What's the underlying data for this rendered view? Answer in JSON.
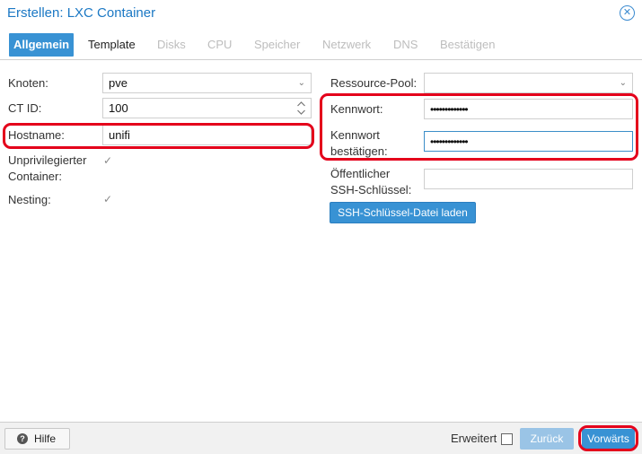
{
  "window": {
    "title": "Erstellen: LXC Container"
  },
  "tabs": [
    "Allgemein",
    "Template",
    "Disks",
    "CPU",
    "Speicher",
    "Netzwerk",
    "DNS",
    "Bestätigen"
  ],
  "left": {
    "node_label": "Knoten:",
    "node_value": "pve",
    "ctid_label": "CT ID:",
    "ctid_value": "100",
    "hostname_label": "Hostname:",
    "hostname_value": "unifi",
    "unpriv_label_1": "Unprivilegierter",
    "unpriv_label_2": "Container:",
    "nesting_label": "Nesting:"
  },
  "right": {
    "pool_label": "Ressource-Pool:",
    "password_label": "Kennwort:",
    "password_value": "•••••••••••••",
    "confirm_label_1": "Kennwort",
    "confirm_label_2": "bestätigen:",
    "confirm_value": "•••••••••••••",
    "ssh_label_1": "Öffentlicher",
    "ssh_label_2": "SSH-Schlüssel:",
    "ssh_button": "SSH-Schlüssel-Datei laden"
  },
  "footer": {
    "help": "Hilfe",
    "advanced": "Erweitert",
    "back": "Zurück",
    "next": "Vorwärts"
  },
  "colors": {
    "accent": "#3892d4",
    "highlight": "#e4001b"
  }
}
